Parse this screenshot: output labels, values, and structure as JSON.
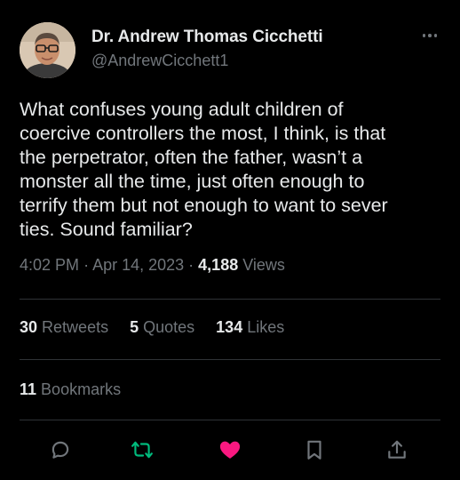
{
  "author": {
    "name": "Dr. Andrew Thomas Cicchetti",
    "handle": "@AndrewCicchett1",
    "avatar_icon": "avatar"
  },
  "tweet": {
    "text": "What confuses young adult children of\ncoercive controllers the most, I think, is that\nthe perpetrator, often the father, wasn’t a\nmonster all the time, just often enough to\nterrify them but not enough to want to sever\nties. Sound familiar?",
    "time": "4:02 PM",
    "date": "Apr 14, 2023",
    "views_count": "4,188",
    "views_label": "Views"
  },
  "stats": {
    "retweets_count": "30",
    "retweets_label": "Retweets",
    "quotes_count": "5",
    "quotes_label": "Quotes",
    "likes_count": "134",
    "likes_label": "Likes",
    "bookmarks_count": "11",
    "bookmarks_label": "Bookmarks"
  },
  "actions": [
    "reply-icon",
    "retweet-icon",
    "like-icon",
    "bookmark-icon",
    "share-icon"
  ],
  "colors": {
    "background": "#000000",
    "text": "#e7e9ea",
    "secondary": "#71767b",
    "divider": "#2f3336",
    "retweet": "#00ba7c",
    "like": "#f91880"
  }
}
